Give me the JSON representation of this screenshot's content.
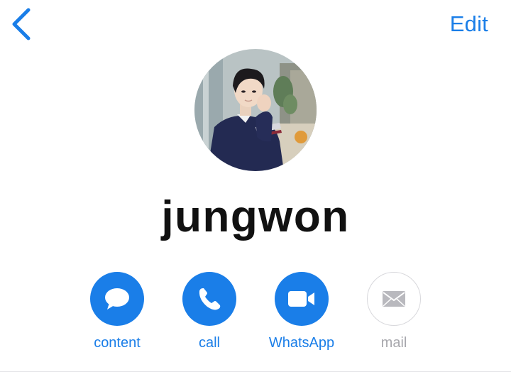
{
  "navigation": {
    "back_icon": "chevron-left-icon",
    "edit_label": "Edit"
  },
  "contact": {
    "name": "jungwon"
  },
  "actions": [
    {
      "label": "content",
      "icon": "message-bubble-icon",
      "enabled": true
    },
    {
      "label": "call",
      "icon": "phone-icon",
      "enabled": true
    },
    {
      "label": "WhatsApp",
      "icon": "video-camera-icon",
      "enabled": true
    },
    {
      "label": "mail",
      "icon": "envelope-icon",
      "enabled": false
    }
  ],
  "colors": {
    "accent": "#1a7ee8",
    "disabled": "#a8a8ad",
    "name_text": "#111111"
  }
}
